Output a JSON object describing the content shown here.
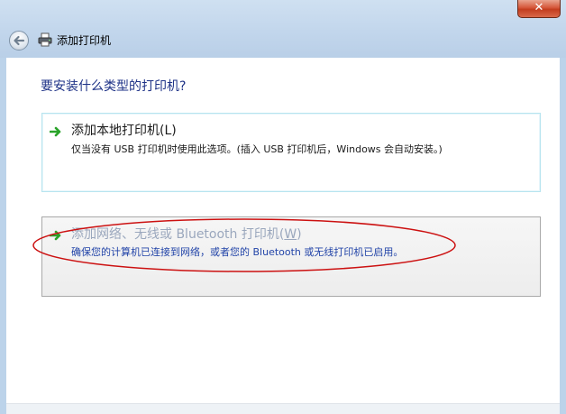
{
  "window": {
    "title": "添加打印机",
    "close_label": "✕",
    "icons": {
      "back": "back-arrow-icon",
      "app": "printer-icon",
      "option": "green-arrow-icon"
    }
  },
  "page": {
    "heading": "要安装什么类型的打印机?"
  },
  "options": [
    {
      "title": "添加本地打印机(L)",
      "description": "仅当没有 USB 打印机时使用此选项。(插入 USB 打印机后，Windows 会自动安装。)"
    },
    {
      "title_prefix": "添加网络、无线或 Bluetooth 打印机(",
      "title_key": "W",
      "title_suffix": ")",
      "description": "确保您的计算机已连接到网络，或者您的 Bluetooth 或无线打印机已启用。"
    }
  ],
  "colors": {
    "heading": "#1e3287",
    "network_description": "#2244a8",
    "annotation": "#cc1111",
    "arrow": "#2aa32a"
  }
}
